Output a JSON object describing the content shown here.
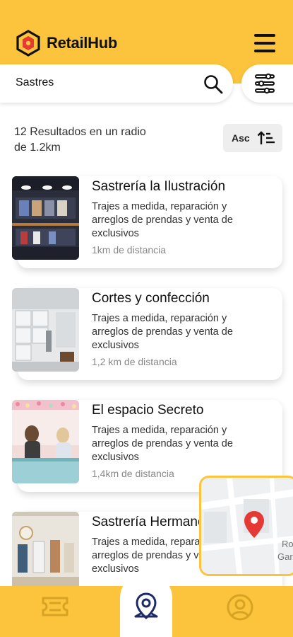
{
  "header": {
    "app_name": "RetailHub",
    "logo_icon": "hexagon-logo-icon",
    "menu_icon": "hamburger-menu-icon",
    "bg_color": "#fcc43c"
  },
  "search": {
    "value": "Sastres",
    "placeholder": "",
    "search_icon": "search-icon",
    "filter_icon": "sliders-filter-icon"
  },
  "results": {
    "summary": "12 Resultados en un radio de 1.2km",
    "sort_label": "Asc",
    "sort_icon": "sort-ascending-icon"
  },
  "listings": [
    {
      "title": "Sastrería la Ilustración",
      "description": "Trajes a medida, reparación y arreglos de prendas y venta de exclusivos",
      "distance": "1km de distancia"
    },
    {
      "title": "Cortes y confección",
      "description": "Trajes a medida, reparación y arreglos de prendas y venta de exclusivos",
      "distance": "1,2 km de distancia"
    },
    {
      "title": "El espacio Secreto",
      "description": "Trajes a medida, reparación y arreglos de prendas y venta de exclusivos",
      "distance": "1,4km de distancia"
    },
    {
      "title": "Sastrería Hermanos",
      "description": "Trajes a medida, reparación y arreglos de prendas y venta de exclusivos",
      "distance": ""
    }
  ],
  "map_preview": {
    "labels": [
      "Ro",
      "Gar"
    ],
    "pin_icon": "map-pin-icon",
    "pin_color": "#e53935"
  },
  "bottom_nav": {
    "items": [
      {
        "icon": "ticket-icon"
      },
      {
        "icon": "location-pin-icon"
      },
      {
        "icon": "user-profile-icon"
      }
    ],
    "accent_color": "#1f2a6b"
  }
}
